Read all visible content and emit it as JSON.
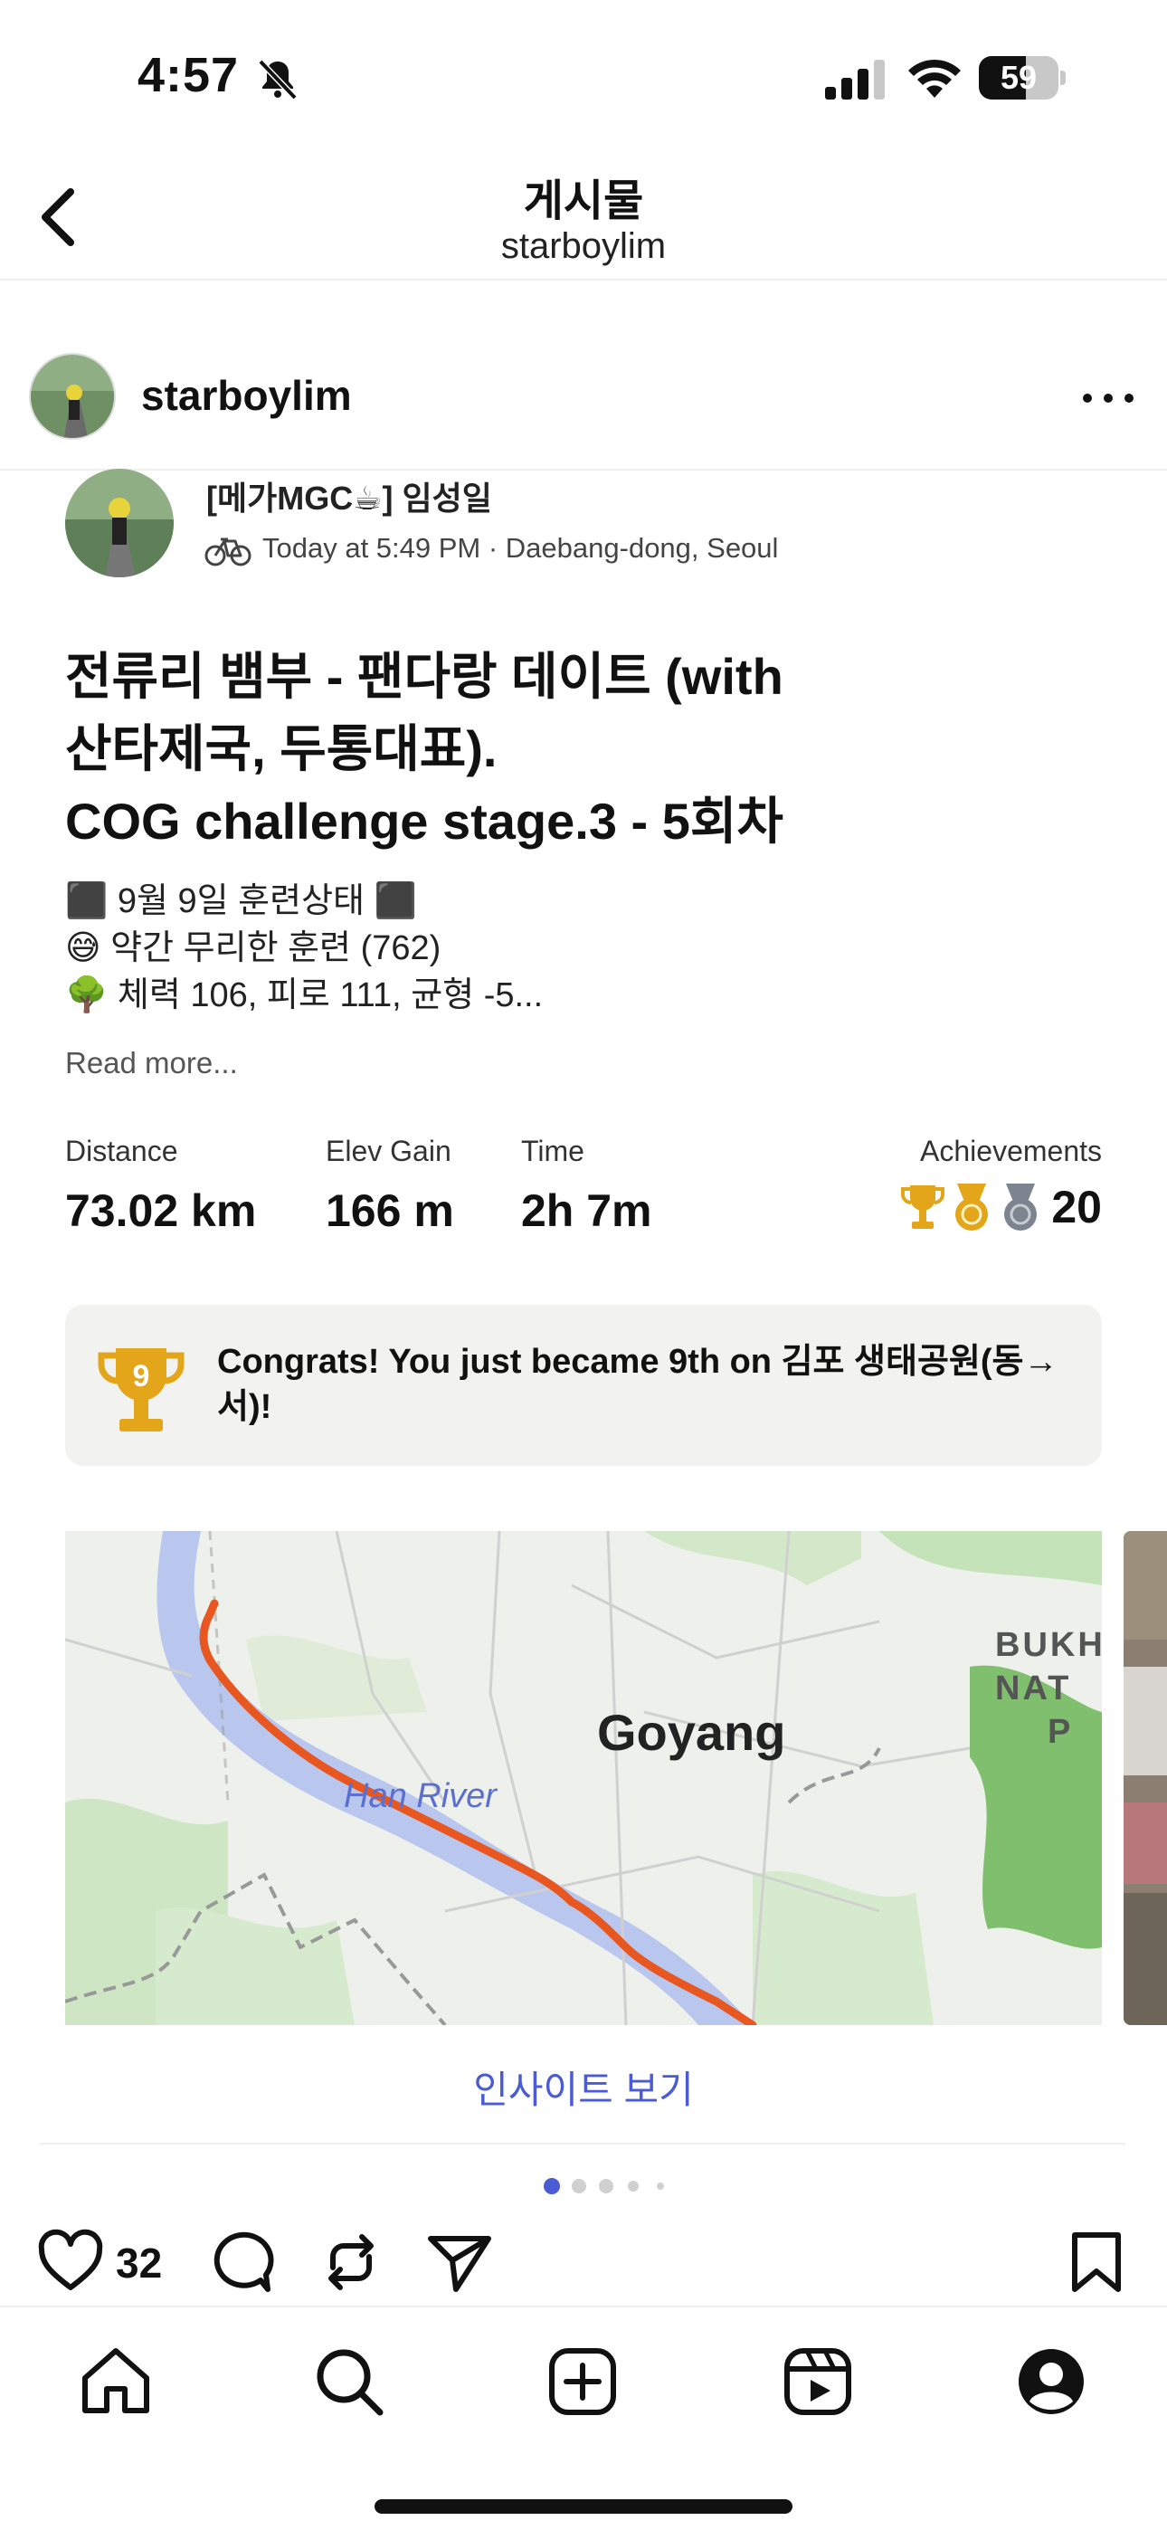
{
  "status_bar": {
    "time": "4:57",
    "battery": "59",
    "battery_level": 0.59
  },
  "nav": {
    "title": "게시물",
    "subtitle": "starboylim"
  },
  "post": {
    "username": "starboylim"
  },
  "activity": {
    "athlete": "[메가MGC☕] 임성일",
    "meta": "Today at 5:49 PM · Daebang-dong, Seoul",
    "title_lines": [
      "전류리 뱀부 - 팬다랑 데이트 (with",
      "산타제국, 두통대표).",
      "COG challenge stage.3 - 5회차"
    ],
    "description": [
      "⬛ 9월 9일 훈련상태 ⬛",
      "😅 약간 무리한 훈련 (762)",
      "🌳 체력 106, 피로 111, 균형 -5..."
    ],
    "read_more": "Read more...",
    "stats": {
      "distance_label": "Distance",
      "distance_value": "73.02 km",
      "elev_label": "Elev Gain",
      "elev_value": "166 m",
      "time_label": "Time",
      "time_value": "2h 7m",
      "achievements_label": "Achievements",
      "achievements_value": "20"
    },
    "congrats": "Congrats! You just became 9th on 김포 생태공원(동→서)!",
    "congrats_rank": "9"
  },
  "map": {
    "label_city": "Goyang",
    "label_river": "Han River",
    "label_park": [
      "BUKH",
      "NAT",
      "P"
    ]
  },
  "insight_link": "인사이트 보기",
  "carousel": {
    "count": 5,
    "active": 0
  },
  "actions": {
    "like_count": "32"
  },
  "colors": {
    "accent_blue": "#4a5bd4",
    "route_orange": "#e8571f",
    "trophy_gold": "#e3a51a"
  }
}
